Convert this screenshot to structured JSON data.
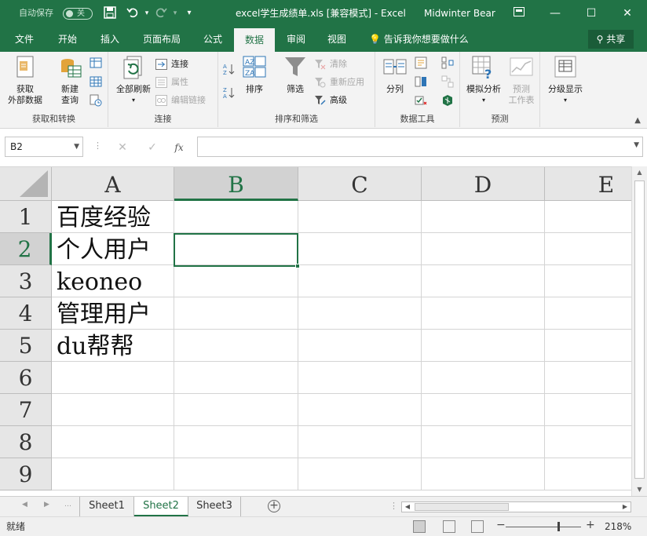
{
  "titlebar": {
    "autosave_label": "自动保存",
    "autosave_state": "关",
    "document_title": "excel学生成绩单.xls  [兼容模式]  -  Excel",
    "user_name": "Midwinter Bear"
  },
  "tabs": [
    "文件",
    "开始",
    "插入",
    "页面布局",
    "公式",
    "数据",
    "审阅",
    "视图"
  ],
  "active_tab": "数据",
  "tell_me": "告诉我你想要做什么",
  "share_label": "共享",
  "ribbon": {
    "get_transform": {
      "label": "获取和转换",
      "get_external": "获取\n外部数据",
      "new_query": "新建\n查询"
    },
    "connections": {
      "label": "连接",
      "refresh_all": "全部刷新",
      "connections": "连接",
      "properties": "属性",
      "edit_links": "编辑链接"
    },
    "sort_filter": {
      "label": "排序和筛选",
      "sort": "排序",
      "filter": "筛选",
      "clear": "清除",
      "reapply": "重新应用",
      "advanced": "高级",
      "az_icon": "AZ",
      "za_icon": "ZA"
    },
    "data_tools": {
      "label": "数据工具",
      "text_to_columns": "分列"
    },
    "forecast": {
      "label": "预测",
      "what_if": "模拟分析",
      "forecast_sheet": "预测\n工作表"
    },
    "outline": {
      "label": "分级显示"
    }
  },
  "formula_bar": {
    "name_box": "B2",
    "fx": "fx",
    "value": ""
  },
  "columns": [
    "A",
    "B",
    "C",
    "D",
    "E"
  ],
  "rows": [
    "1",
    "2",
    "3",
    "4",
    "5",
    "6",
    "7",
    "8",
    "9"
  ],
  "cells": {
    "A1": "百度经验",
    "A2": "个人用户",
    "A3": "keoneo",
    "A4": "管理用户",
    "A5": "du帮帮"
  },
  "selected_cell": "B2",
  "sheets": [
    "Sheet1",
    "Sheet2",
    "Sheet3"
  ],
  "active_sheet": "Sheet2",
  "status": {
    "ready": "就绪",
    "zoom": "218%"
  },
  "colors": {
    "accent": "#217346"
  }
}
